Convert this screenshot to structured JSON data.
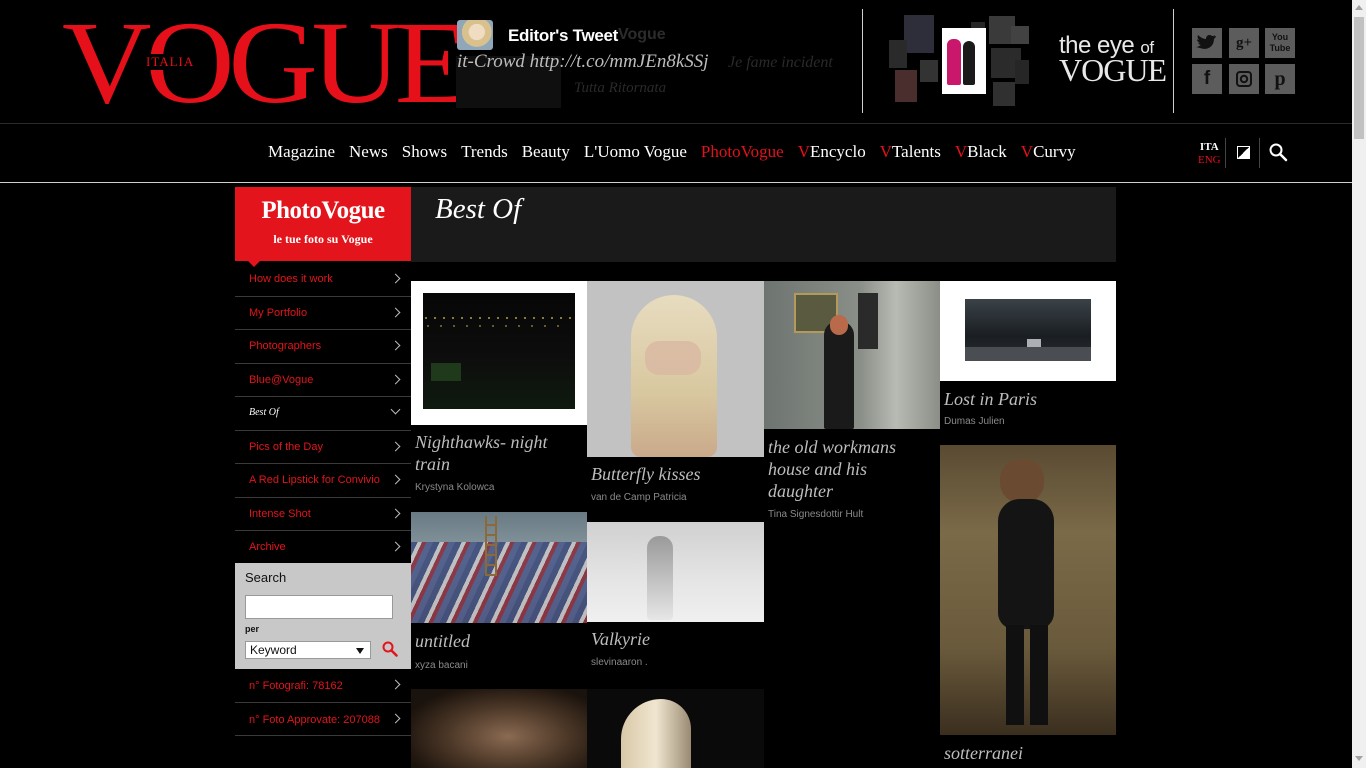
{
  "header": {
    "logo": {
      "main": "VOGUE",
      "sub": "ITALIA"
    },
    "tweet": {
      "title": "Editor's Tweet",
      "title_ghost": "Vogue",
      "text": "it-Crowd http://t.co/mmJEn8kSSj",
      "ghost_text": "Je fame incident",
      "ghost_text2": "Tutta Ritornata"
    },
    "eye_of_vogue": {
      "line1": "the eye",
      "line1b": "of",
      "line2": "VOGUE"
    },
    "social": [
      {
        "icon": "twitter-icon",
        "glyph": "t"
      },
      {
        "icon": "google-plus-icon",
        "glyph": "g+"
      },
      {
        "icon": "youtube-icon",
        "glyph": "You"
      },
      {
        "icon": "facebook-icon",
        "glyph": "f"
      },
      {
        "icon": "instagram-icon",
        "glyph": "◙"
      },
      {
        "icon": "pinterest-icon",
        "glyph": "p"
      }
    ]
  },
  "nav": {
    "items": [
      {
        "label": "Magazine",
        "red_prefix": ""
      },
      {
        "label": "News",
        "red_prefix": ""
      },
      {
        "label": "Shows",
        "red_prefix": ""
      },
      {
        "label": "Trends",
        "red_prefix": ""
      },
      {
        "label": "Beauty",
        "red_prefix": ""
      },
      {
        "label": "L'Uomo Vogue",
        "red_prefix": ""
      },
      {
        "label": "PhotoVogue",
        "red_prefix": ""
      },
      {
        "label": "Encyclo",
        "red_prefix": "V"
      },
      {
        "label": "Talents",
        "red_prefix": "V"
      },
      {
        "label": "Black",
        "red_prefix": "V"
      },
      {
        "label": "Curvy",
        "red_prefix": "V"
      }
    ],
    "active": "PhotoVogue",
    "lang": {
      "current": "ITA",
      "other": "ENG"
    }
  },
  "sidebar": {
    "logo": {
      "title": "PhotoVogue",
      "subtitle": "le tue foto su Vogue"
    },
    "menu": [
      "How does it work",
      "My Portfolio",
      "Photographers",
      "Blue@Vogue",
      "Best Of",
      "Pics of the Day",
      "A Red Lipstick for Convivio",
      "Intense Shot",
      "Archive"
    ],
    "active_menu": "Best Of",
    "search": {
      "label": "Search",
      "value": "",
      "per_label": "per",
      "select_value": "Keyword"
    },
    "stats": [
      "n° Fotografi: 78162",
      "n° Foto Approvate: 207088"
    ]
  },
  "main": {
    "title": "Best Of",
    "photos": [
      {
        "title": "Nighthawks- night train",
        "author": "Krystyna Kolowca"
      },
      {
        "title": "Butterfly kisses",
        "author": "van de Camp Patricia"
      },
      {
        "title": "the old workmans house and his daughter",
        "author": "Tina Signesdottir Hult"
      },
      {
        "title": "Lost in Paris",
        "author": "Dumas Julien"
      },
      {
        "title": "untitled",
        "author": "xyza bacani"
      },
      {
        "title": "Valkyrie",
        "author": "slevinaaron ."
      },
      {
        "title": "sotterranei",
        "author": ""
      }
    ]
  },
  "colors": {
    "accent": "#e3141b",
    "background": "#000000"
  }
}
